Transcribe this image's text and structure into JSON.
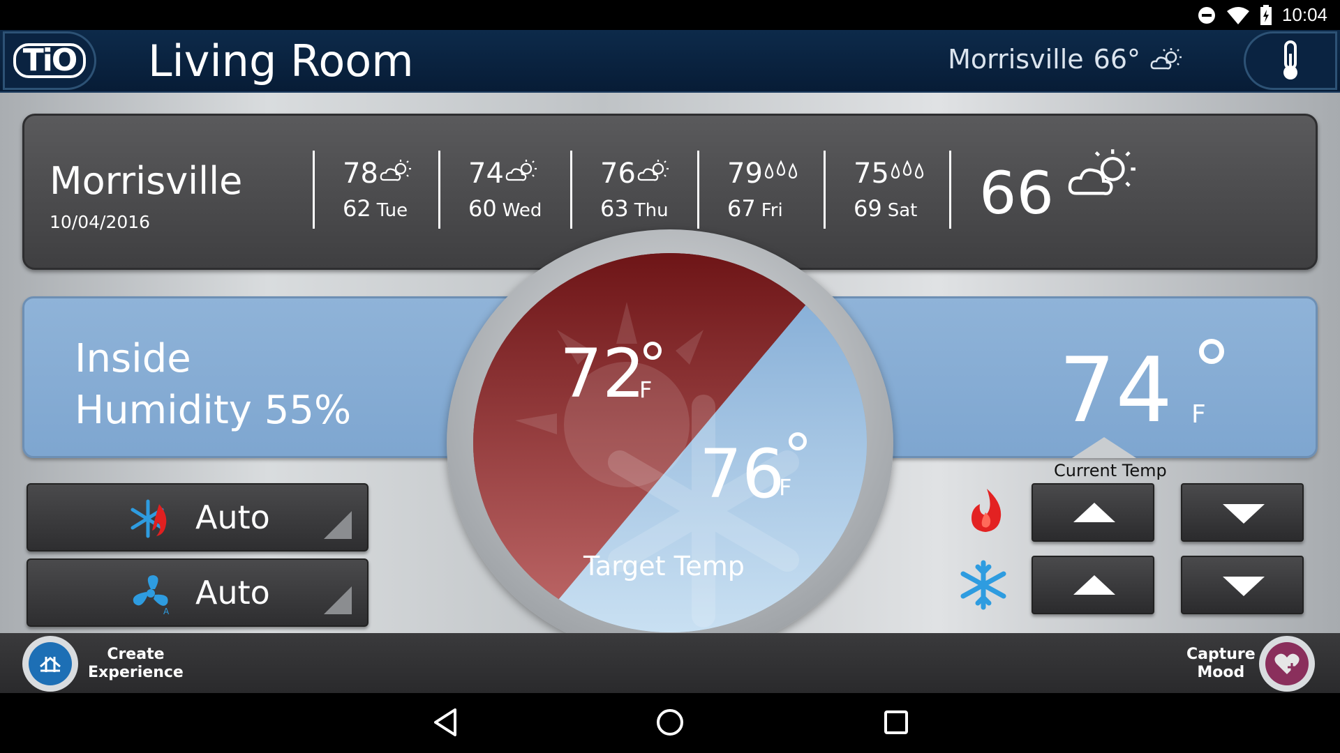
{
  "status": {
    "time": "10:04"
  },
  "header": {
    "logo": "TiO",
    "room": "Living Room",
    "weather_city": "Morrisville",
    "weather_temp": "66"
  },
  "forecast": {
    "city": "Morrisville",
    "date": "10/04/2016",
    "days": [
      {
        "hi": "78",
        "lo": "62",
        "day": "Tue",
        "icon": "partly-sunny-icon"
      },
      {
        "hi": "74",
        "lo": "60",
        "day": "Wed",
        "icon": "partly-sunny-icon"
      },
      {
        "hi": "76",
        "lo": "63",
        "day": "Thu",
        "icon": "partly-sunny-icon"
      },
      {
        "hi": "79",
        "lo": "67",
        "day": "Fri",
        "icon": "rain-drops-icon"
      },
      {
        "hi": "75",
        "lo": "69",
        "day": "Sat",
        "icon": "rain-drops-icon"
      }
    ],
    "current": "66"
  },
  "humidity": {
    "line1": "Inside",
    "line2": "Humidity 55%"
  },
  "current_temp": {
    "value": "74",
    "unit": "F",
    "label": "Current Temp"
  },
  "target": {
    "heat": "72",
    "heat_unit": "F",
    "cool": "76",
    "cool_unit": "F",
    "label": "Target Temp"
  },
  "modes": {
    "system_label": "Auto",
    "fan_label": "Auto"
  },
  "footer": {
    "create_line1": "Create",
    "create_line2": "Experience",
    "capture_line1": "Capture",
    "capture_line2": "Mood"
  },
  "colors": {
    "heat": "#8e1f22",
    "cool": "#a9cbe6",
    "header": "#0b2443",
    "panel": "#4a4a4c"
  }
}
